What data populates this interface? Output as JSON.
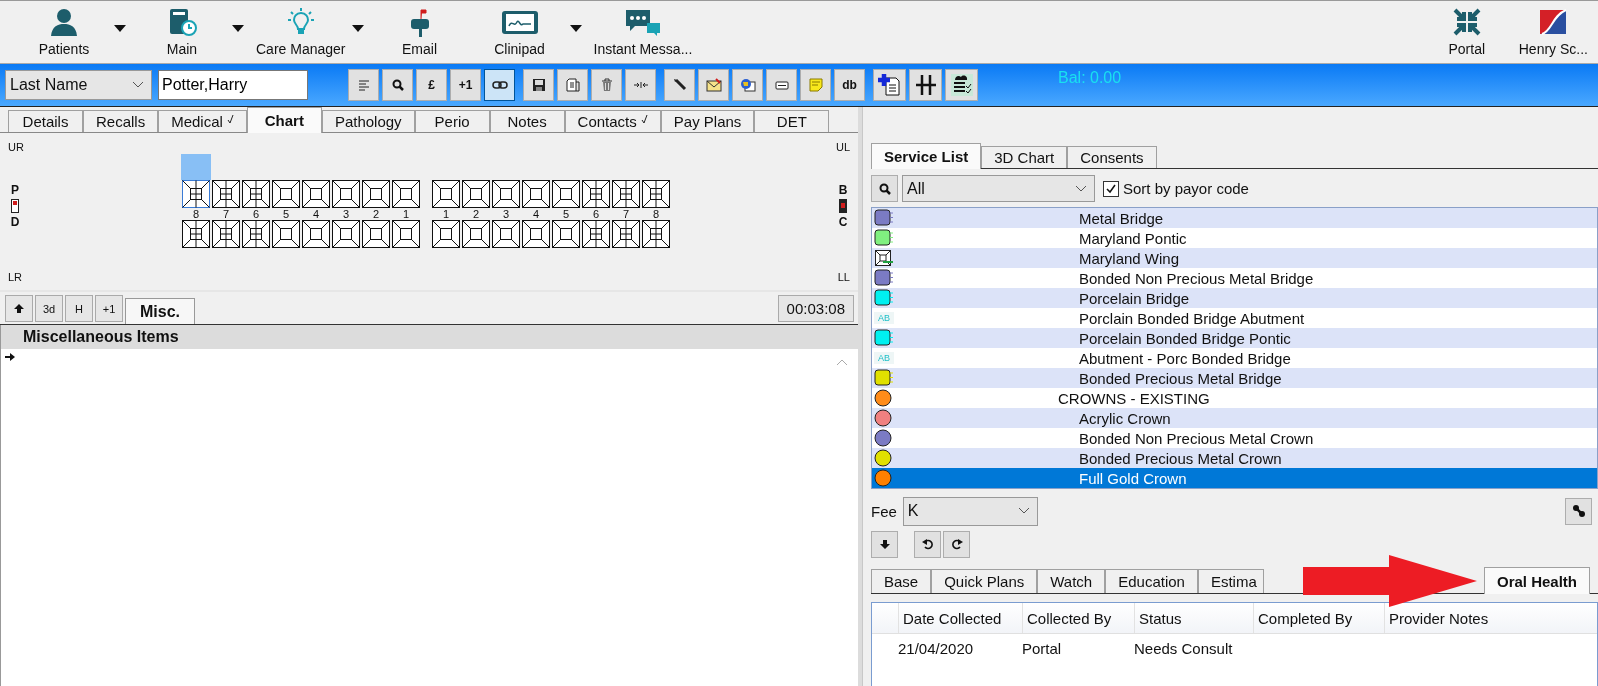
{
  "top_toolbar": {
    "items": [
      {
        "label": "Patients",
        "kind": "person",
        "dropdown": true
      },
      {
        "label": "Main",
        "kind": "book",
        "dropdown": true
      },
      {
        "label": "Care Manager",
        "kind": "bulb",
        "dropdown": true
      },
      {
        "label": "Email",
        "kind": "mailbox",
        "dropdown": false
      },
      {
        "label": "Clinipad",
        "kind": "tablet",
        "dropdown": true
      },
      {
        "label": "Instant Messa...",
        "kind": "chat",
        "dropdown": false
      }
    ],
    "right_items": [
      {
        "label": "Portal",
        "kind": "arrows"
      },
      {
        "label": "Henry Sc...",
        "kind": "flag"
      }
    ]
  },
  "patient_bar": {
    "search_type": "Last Name",
    "search_value": "Potter,Harry",
    "balance": "Bal: 0.00",
    "tool_groups": [
      {
        "large": false,
        "tools": [
          {
            "kind": "align",
            "pressed": false
          },
          {
            "kind": "search",
            "pressed": false
          },
          {
            "kind": "text",
            "label": "£",
            "pressed": false
          },
          {
            "kind": "text",
            "label": "+1",
            "pressed": false
          },
          {
            "kind": "link",
            "pressed": true
          }
        ]
      },
      {
        "large": false,
        "tools": [
          {
            "kind": "save",
            "pressed": false
          },
          {
            "kind": "print",
            "pressed": false
          },
          {
            "kind": "trash",
            "pressed": false
          },
          {
            "kind": "merge",
            "pressed": false
          }
        ]
      },
      {
        "large": false,
        "tools": [
          {
            "kind": "pen",
            "pressed": false
          },
          {
            "kind": "envelope",
            "pressed": false
          },
          {
            "kind": "globe",
            "pressed": false
          },
          {
            "kind": "card",
            "pressed": false
          },
          {
            "kind": "note",
            "pressed": false
          },
          {
            "kind": "text",
            "label": "db",
            "pressed": false
          }
        ]
      },
      {
        "large": true,
        "tools": [
          {
            "kind": "add-doc",
            "pressed": false
          },
          {
            "kind": "hash",
            "pressed": false
          },
          {
            "kind": "cloud-list",
            "pressed": false
          }
        ]
      }
    ]
  },
  "record_tabs": [
    {
      "label": "Details",
      "selected": false,
      "checked": false
    },
    {
      "label": "Recalls",
      "selected": false,
      "checked": false
    },
    {
      "label": "Medical",
      "selected": false,
      "checked": true
    },
    {
      "label": "Chart",
      "selected": true,
      "checked": false
    },
    {
      "label": "Pathology",
      "selected": false,
      "checked": false
    },
    {
      "label": "Perio",
      "selected": false,
      "checked": false
    },
    {
      "label": "Notes",
      "selected": false,
      "checked": false
    },
    {
      "label": "Contacts",
      "selected": false,
      "checked": true
    },
    {
      "label": "Pay Plans",
      "selected": false,
      "checked": false
    },
    {
      "label": "DET",
      "selected": false,
      "checked": false
    }
  ],
  "dental_chart": {
    "quadrants": [
      "UR",
      "UL",
      "LR",
      "LL"
    ],
    "left_sides": [
      "P",
      "D"
    ],
    "right_sides": [
      "B",
      "C"
    ],
    "upper_teeth": [
      {
        "number": "8",
        "kind": "molar",
        "selected": true
      },
      {
        "number": "7",
        "kind": "molar",
        "selected": false
      },
      {
        "number": "6",
        "kind": "molar",
        "selected": false
      },
      {
        "number": "5",
        "kind": "plain",
        "selected": false
      },
      {
        "number": "4",
        "kind": "plain",
        "selected": false
      },
      {
        "number": "3",
        "kind": "plain",
        "selected": false
      },
      {
        "number": "2",
        "kind": "plain",
        "selected": false
      },
      {
        "number": "1",
        "kind": "plain",
        "selected": false
      },
      {
        "number": "1",
        "kind": "plain",
        "selected": false
      },
      {
        "number": "2",
        "kind": "plain",
        "selected": false
      },
      {
        "number": "3",
        "kind": "plain",
        "selected": false
      },
      {
        "number": "4",
        "kind": "plain",
        "selected": false
      },
      {
        "number": "5",
        "kind": "plain",
        "selected": false
      },
      {
        "number": "6",
        "kind": "molar",
        "selected": false
      },
      {
        "number": "7",
        "kind": "molar",
        "selected": false
      },
      {
        "number": "8",
        "kind": "molar",
        "selected": false
      }
    ],
    "lower_teeth": [
      {
        "kind": "molar"
      },
      {
        "kind": "molar"
      },
      {
        "kind": "molar"
      },
      {
        "kind": "plain"
      },
      {
        "kind": "plain"
      },
      {
        "kind": "plain"
      },
      {
        "kind": "plain"
      },
      {
        "kind": "plain"
      },
      {
        "kind": "plain"
      },
      {
        "kind": "plain"
      },
      {
        "kind": "plain"
      },
      {
        "kind": "plain"
      },
      {
        "kind": "plain"
      },
      {
        "kind": "molar"
      },
      {
        "kind": "molar"
      },
      {
        "kind": "molar"
      }
    ]
  },
  "misc_panel": {
    "buttons": [
      {
        "kind": "up-arrow"
      },
      {
        "kind": "text",
        "label": "3d"
      },
      {
        "kind": "text",
        "label": "H"
      },
      {
        "kind": "text",
        "label": "+1"
      }
    ],
    "tab": {
      "label": "Misc.",
      "selected": true
    },
    "timer": "00:03:08",
    "header": "Miscellaneous Items"
  },
  "service_tabs": [
    {
      "label": "Service List",
      "selected": true
    },
    {
      "label": "3D Chart",
      "selected": false
    },
    {
      "label": "Consents",
      "selected": false
    }
  ],
  "service_filter": {
    "category": "All",
    "sort_by_payor": {
      "label": "Sort by payor code",
      "checked": true
    }
  },
  "services": [
    {
      "name": "Metal Bridge",
      "kind": "bridge",
      "color": "#7b7bc4",
      "selected": false
    },
    {
      "name": "Maryland Pontic",
      "kind": "bridge",
      "color": "#80f080",
      "selected": false
    },
    {
      "name": "Maryland Wing",
      "kind": "wing",
      "selected": false
    },
    {
      "name": "Bonded Non Precious Metal Bridge",
      "kind": "bridge",
      "color": "#7b7bc4",
      "selected": false
    },
    {
      "name": "Porcelain Bridge",
      "kind": "bridge",
      "color": "#00f0f0",
      "selected": false
    },
    {
      "name": "Porclain Bonded Bridge Abutment",
      "kind": "letters",
      "icon_text": "AB",
      "selected": false
    },
    {
      "name": "Porcelain Bonded Bridge Pontic",
      "kind": "bridge",
      "color": "#00f0f0",
      "selected": false
    },
    {
      "name": "Abutment - Porc Bonded Bridge",
      "kind": "letters",
      "icon_text": "AB",
      "selected": false
    },
    {
      "name": "Bonded Precious Metal Bridge",
      "kind": "bridge",
      "color": "#e0e000",
      "selected": false
    },
    {
      "name": "CROWNS - EXISTING",
      "kind": "group",
      "color": "#ff8c1a",
      "selected": false
    },
    {
      "name": "Acrylic Crown",
      "kind": "crown",
      "color": "#f08080",
      "selected": false
    },
    {
      "name": "Bonded Non Precious Metal Crown",
      "kind": "crown",
      "color": "#7b7bc4",
      "selected": false
    },
    {
      "name": "Bonded Precious Metal Crown",
      "kind": "crown",
      "color": "#e0e000",
      "selected": false
    },
    {
      "name": "Full Gold Crown",
      "kind": "crown",
      "color": "#ff8000",
      "selected": true
    }
  ],
  "fee": {
    "label": "Fee",
    "value": "K"
  },
  "plan_tabs": [
    {
      "label": "Base",
      "selected": false
    },
    {
      "label": "Quick Plans",
      "selected": false
    },
    {
      "label": "Watch",
      "selected": false
    },
    {
      "label": "Education",
      "selected": false
    },
    {
      "label": "Estima",
      "selected": false
    },
    {
      "label": "Oral Health",
      "selected": true
    }
  ],
  "oral_health_table": {
    "columns": [
      "Date Collected",
      "Collected By",
      "Status",
      "Completed By",
      "Provider Notes"
    ],
    "rows": [
      [
        "21/04/2020",
        "Portal",
        "Needs Consult"
      ]
    ]
  }
}
